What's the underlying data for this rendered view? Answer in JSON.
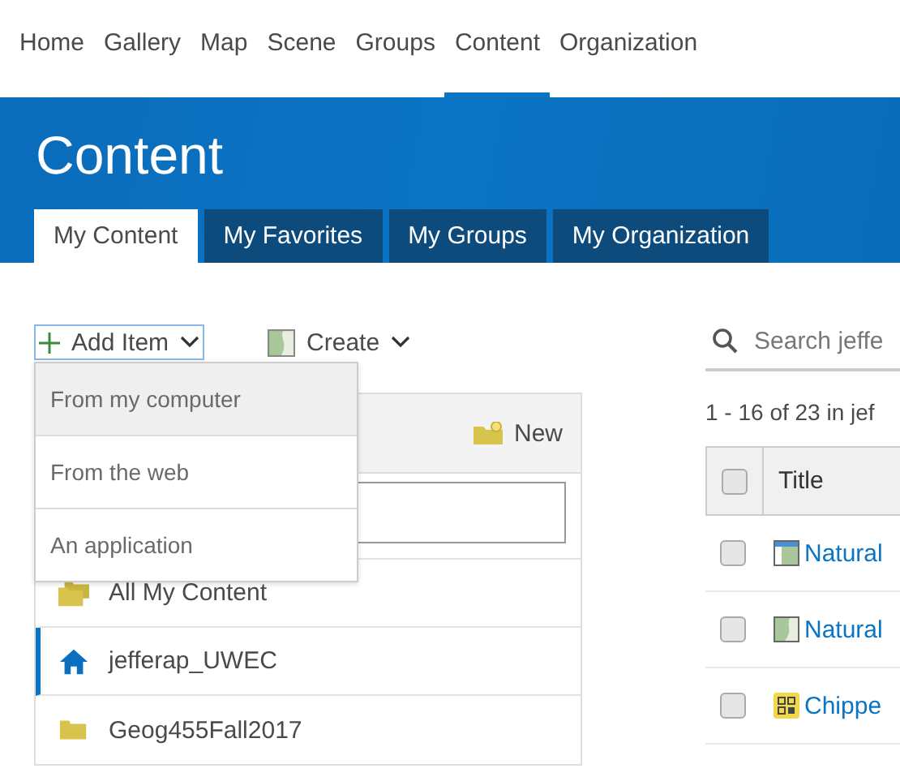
{
  "nav": [
    {
      "label": "Home",
      "selected": false
    },
    {
      "label": "Gallery",
      "selected": false
    },
    {
      "label": "Map",
      "selected": false
    },
    {
      "label": "Scene",
      "selected": false
    },
    {
      "label": "Groups",
      "selected": false
    },
    {
      "label": "Content",
      "selected": true
    },
    {
      "label": "Organization",
      "selected": false
    }
  ],
  "banner": {
    "title": "Content"
  },
  "tabs": [
    {
      "label": "My Content",
      "selected": true
    },
    {
      "label": "My Favorites",
      "selected": false
    },
    {
      "label": "My Groups",
      "selected": false
    },
    {
      "label": "My Organization",
      "selected": false
    }
  ],
  "toolbar": {
    "add_item": "Add Item",
    "create": "Create"
  },
  "add_item_menu": [
    {
      "label": "From my computer",
      "highlighted": true
    },
    {
      "label": "From the web",
      "highlighted": false
    },
    {
      "label": "An application",
      "highlighted": false
    }
  ],
  "folders": {
    "new_button": "New",
    "items": [
      {
        "label": "All My Content",
        "kind": "folders",
        "selected": false
      },
      {
        "label": "jefferap_UWEC",
        "kind": "home",
        "selected": true
      },
      {
        "label": "Geog455Fall2017",
        "kind": "folder",
        "selected": false
      }
    ]
  },
  "search": {
    "placeholder": "Search jeffe"
  },
  "result_count": "1 - 16 of 23 in jef",
  "table": {
    "columns": [
      "Title"
    ],
    "header_checked": false,
    "rows": [
      {
        "title": "Natural",
        "kind": "web-map",
        "checked": false
      },
      {
        "title": "Natural",
        "kind": "imagery",
        "checked": false
      },
      {
        "title": "Chippe",
        "kind": "app",
        "checked": false
      }
    ]
  }
}
